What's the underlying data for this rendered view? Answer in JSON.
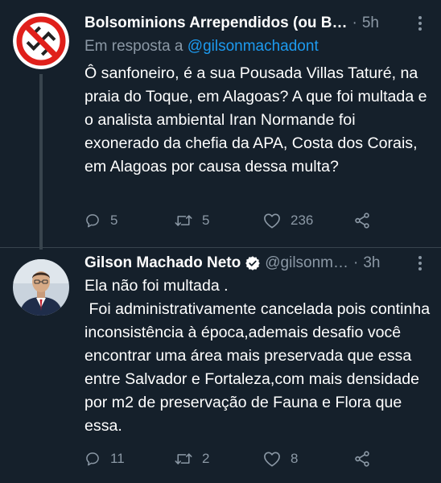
{
  "tweets": [
    {
      "author_name": "Bolsominions Arrependidos (ou B…",
      "separator": "·",
      "time": "5h",
      "reply_prefix": "Em resposta a",
      "reply_mention": "@gilsonmachadont",
      "text": "Ô sanfoneiro, é a sua Pousada Villas Taturé, na praia do Toque, em Alagoas? A que foi multada e o analista ambiental Iran Normande foi exonerado da chefia da APA, Costa dos Corais, em Alagoas por causa dessa multa?",
      "replies": "5",
      "retweets": "5",
      "likes": "236",
      "avatar_icon": "prohibited-swastika-icon"
    },
    {
      "author_name": "Gilson Machado Neto",
      "handle": "@gilsonm…",
      "separator": "·",
      "time": "3h",
      "text": "Ela não foi multada .\n Foi administrativamente cancelada pois continha inconsistência à época,ademais desafio você encontrar uma área mais preservada que essa entre Salvador e Fortaleza,com mais densidade por m2 de preservação de Fauna e Flora que essa.",
      "replies": "11",
      "retweets": "2",
      "likes": "8",
      "verified_icon": "verified-badge-icon"
    }
  ],
  "colors": {
    "background": "#15202b",
    "text": "#ffffff",
    "secondary": "#8b98a5",
    "link": "#1d9bf0",
    "divider": "#38444d"
  }
}
